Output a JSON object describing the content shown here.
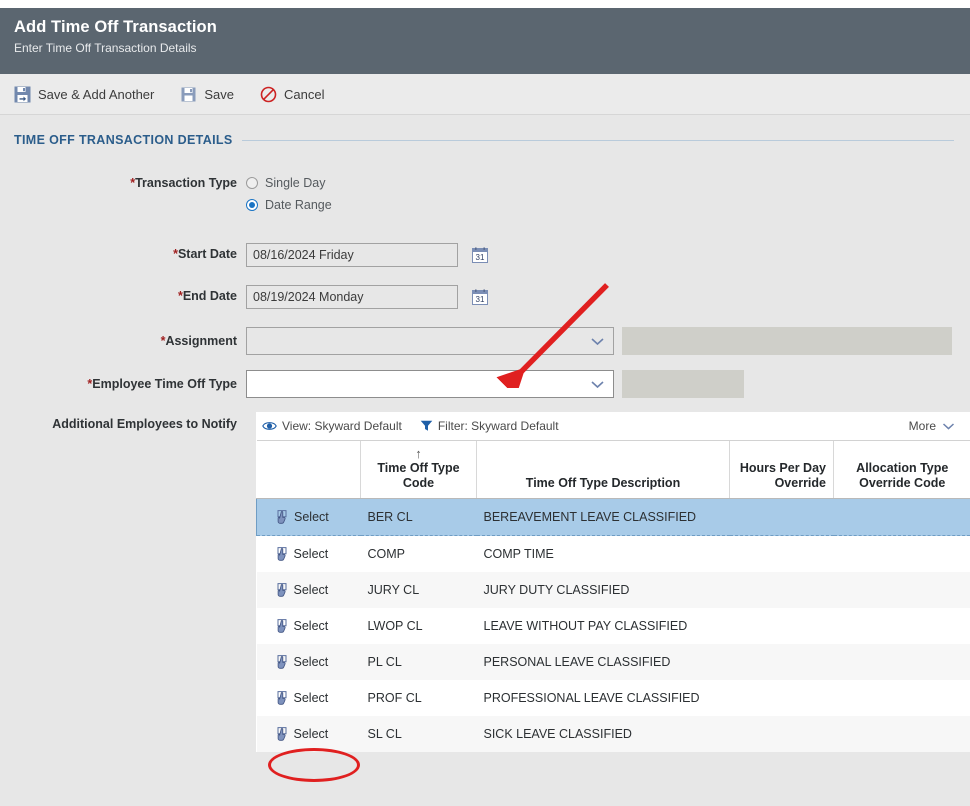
{
  "header": {
    "title": "Add Time Off Transaction",
    "subtitle": "Enter Time Off Transaction Details",
    "bg_color": "#5b6670"
  },
  "toolbar": {
    "save_add_another_label": "Save & Add Another",
    "save_label": "Save",
    "cancel_label": "Cancel"
  },
  "section": {
    "title": "TIME OFF TRANSACTION DETAILS",
    "accent_color": "#2b5d8b"
  },
  "form": {
    "transaction_type": {
      "label": "*Transaction Type",
      "options": [
        {
          "label": "Single Day",
          "selected": false
        },
        {
          "label": "Date Range",
          "selected": true
        }
      ]
    },
    "start_date": {
      "label": "*Start Date",
      "value": "08/16/2024 Friday",
      "placeholder": ""
    },
    "end_date": {
      "label": "*End Date",
      "value": "08/19/2024 Monday",
      "placeholder": ""
    },
    "assignment": {
      "label": "*Assignment",
      "value": "",
      "placeholder": ""
    },
    "employee_time_off_type": {
      "label": "*Employee Time Off Type",
      "value": "",
      "placeholder": ""
    },
    "additional_employees": {
      "label": "Additional Employees to Notify"
    }
  },
  "grid": {
    "view_label": "View: Skyward Default",
    "filter_label": "Filter: Skyward Default",
    "more_label": "More",
    "sort_indicator": "↑",
    "columns": [
      {
        "key": "select",
        "label": "",
        "align": "left"
      },
      {
        "key": "code",
        "label": "Time Off Type Code",
        "align": "left",
        "sorted": true
      },
      {
        "key": "description",
        "label": "Time Off Type Description",
        "align": "left"
      },
      {
        "key": "hours_per_day_override",
        "label": "Hours Per Day Override",
        "align": "right"
      },
      {
        "key": "allocation_type_override_code",
        "label": "Allocation Type Override Code",
        "align": "left"
      }
    ],
    "select_action_label": "Select",
    "rows": [
      {
        "code": "BER CL",
        "description": "BEREAVEMENT LEAVE CLASSIFIED",
        "hours_per_day_override": "",
        "allocation_type_override_code": "",
        "selected": true
      },
      {
        "code": "COMP",
        "description": "COMP TIME",
        "hours_per_day_override": "",
        "allocation_type_override_code": "",
        "selected": false
      },
      {
        "code": "JURY CL",
        "description": "JURY DUTY CLASSIFIED",
        "hours_per_day_override": "",
        "allocation_type_override_code": "",
        "selected": false
      },
      {
        "code": "LWOP CL",
        "description": "LEAVE WITHOUT PAY CLASSIFIED",
        "hours_per_day_override": "",
        "allocation_type_override_code": "",
        "selected": false
      },
      {
        "code": "PL CL",
        "description": "PERSONAL LEAVE CLASSIFIED",
        "hours_per_day_override": "",
        "allocation_type_override_code": "",
        "selected": false
      },
      {
        "code": "PROF CL",
        "description": "PROFESSIONAL LEAVE CLASSIFIED",
        "hours_per_day_override": "",
        "allocation_type_override_code": "",
        "selected": false
      },
      {
        "code": "SL CL",
        "description": "SICK LEAVE CLASSIFIED",
        "hours_per_day_override": "",
        "allocation_type_override_code": "",
        "selected": false
      }
    ]
  },
  "annotations": {
    "arrow_color": "#e02020",
    "ellipse_color": "#e02020"
  }
}
